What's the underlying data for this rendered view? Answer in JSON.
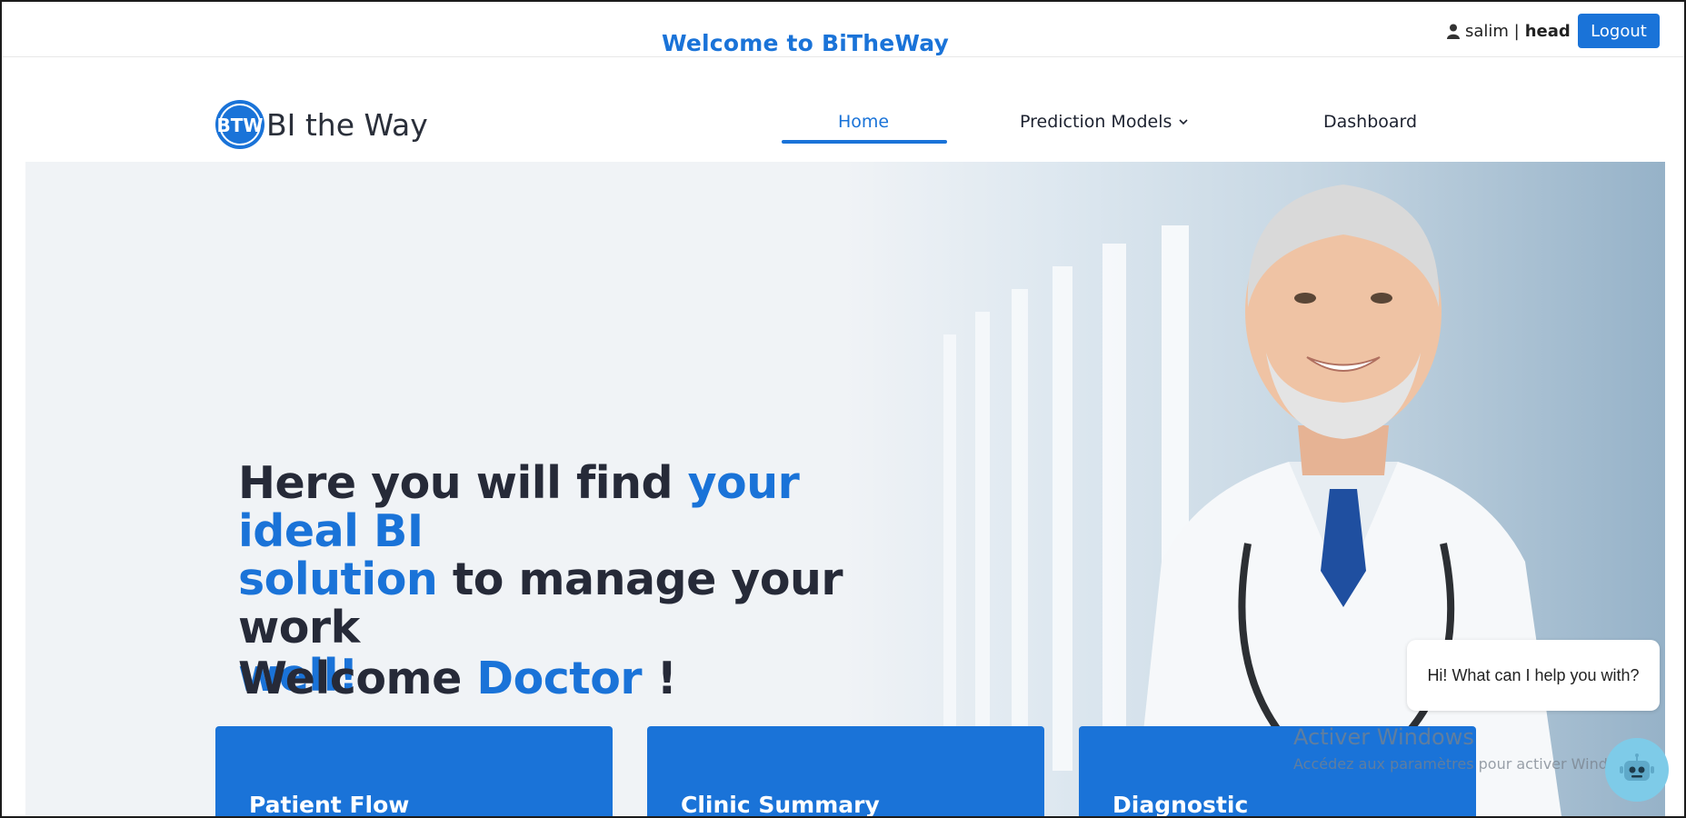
{
  "topbar": {
    "welcome": "Welcome to BiTheWay",
    "user_name": "salim |",
    "user_role": "head",
    "logout_label": "Logout"
  },
  "brand": {
    "logo_text": "BI the Way",
    "logo_initials": "BTW"
  },
  "nav": {
    "home": "Home",
    "prediction_models": "Prediction Models",
    "dashboard": "Dashboard"
  },
  "hero": {
    "line1_a": "Here you will find ",
    "line1_b": "your ideal BI",
    "line2_a": "solution",
    "line2_b": " to manage your work",
    "line3": "well!",
    "welcome_a": "Welcome ",
    "welcome_b": "Doctor",
    "welcome_c": " !"
  },
  "cards": [
    {
      "title": "Patient Flow"
    },
    {
      "title": "Clinic Summary"
    },
    {
      "title": "Diagnostic"
    }
  ],
  "watermark": {
    "line1": "Activer Windows",
    "line2": "Accédez aux paramètres pour activer Windows."
  },
  "chat": {
    "prompt": "Hi! What can I help you with?"
  },
  "colors": {
    "accent": "#1a73d8",
    "heading": "#262a38"
  },
  "icons": {
    "user": "user-icon",
    "chevron": "chevron-down-icon",
    "chatbot": "robot-icon"
  }
}
